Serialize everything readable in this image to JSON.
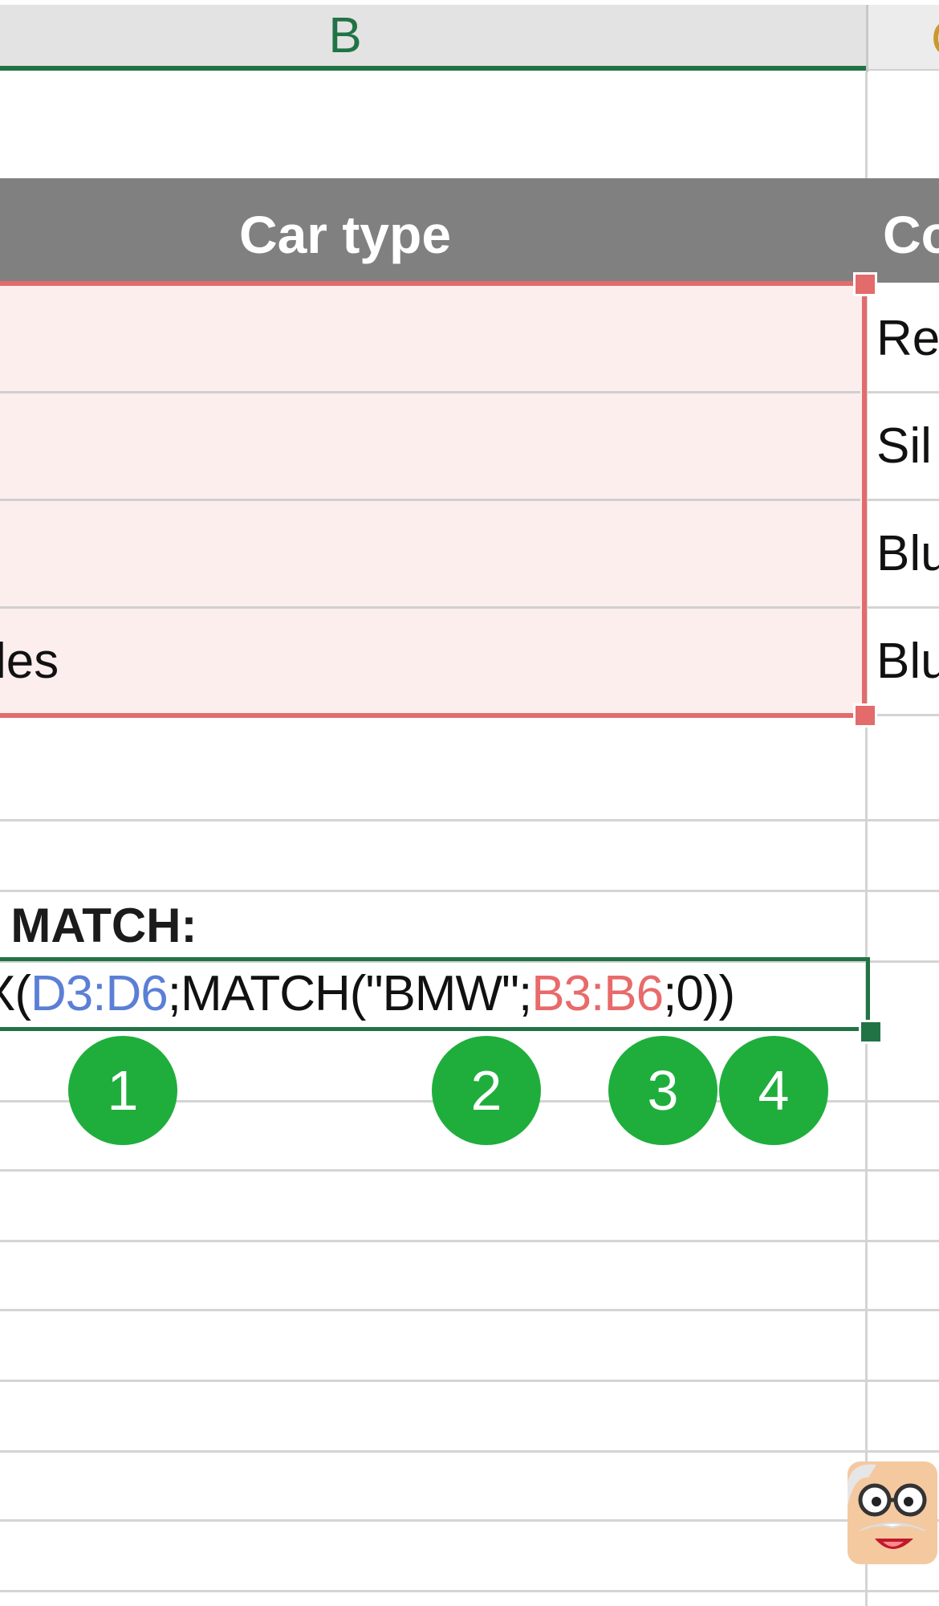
{
  "column_headers": {
    "b": "B",
    "c": "C"
  },
  "table": {
    "header_b": "Car type",
    "header_c": "Co",
    "rows": [
      {
        "b": "",
        "c": "Re"
      },
      {
        "b": "",
        "c": "Sil"
      },
      {
        "b": "",
        "c": "Blu"
      },
      {
        "b": "les",
        "c": "Blu"
      }
    ]
  },
  "label": "/ MATCH:",
  "formula": {
    "prefix": "X(",
    "ref1": "D3:D6",
    "mid": ";MATCH(\"BMW\";",
    "ref2": "B3:B6",
    "suffix": ";0))"
  },
  "badges": [
    "1",
    "2",
    "3",
    "4"
  ],
  "colors": {
    "accent_green": "#217346",
    "badge_green": "#1fae3c",
    "range_red": "#e36b6b",
    "ref_blue": "#5b7fd6"
  },
  "icons": [
    "professor-avatar-icon"
  ]
}
